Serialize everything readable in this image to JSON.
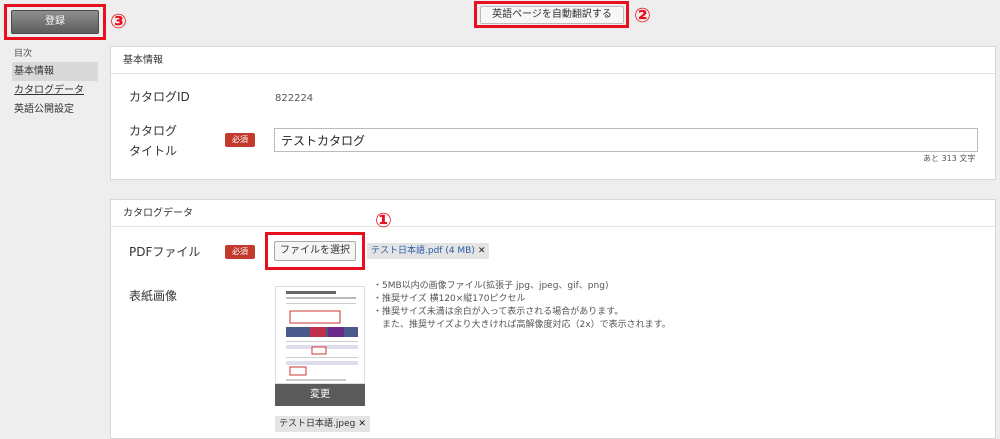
{
  "toolbar": {
    "register_label": "登録",
    "translate_label": "英語ページを自動翻訳する"
  },
  "annotations": {
    "one": "①",
    "two": "②",
    "three": "③"
  },
  "sidebar": {
    "heading": "目次",
    "items": [
      {
        "label": "基本情報",
        "state": "active"
      },
      {
        "label": "カタログデータ",
        "state": "link"
      },
      {
        "label": "英語公開設定",
        "state": "normal"
      }
    ]
  },
  "basic_info": {
    "section_title": "基本情報",
    "catalog_id_label": "カタログID",
    "catalog_id_value": "822224",
    "catalog_title_label_line1": "カタログ",
    "catalog_title_label_line2": "タイトル",
    "required_badge": "必須",
    "catalog_title_value": "テストカタログ",
    "chars_remaining": "あと 313 文字"
  },
  "catalog_data": {
    "section_title": "カタログデータ",
    "pdf_label": "PDFファイル",
    "required_badge": "必須",
    "file_select_label": "ファイルを選択",
    "pdf_file_name": "テスト日本語.pdf (4 MB)",
    "remove_symbol": "✕",
    "cover_label": "表紙画像",
    "notes": [
      "・5MB以内の画像ファイル(拡張子 jpg、jpeg、gif、png)",
      "・推奨サイズ 横120×縦170ピクセル",
      "・推奨サイズ未満は余白が入って表示される場合があります。",
      "　また、推奨サイズより大きければ高解像度対応（2x）で表示されます。"
    ],
    "change_label": "変更",
    "cover_file_name": "テスト日本語.jpeg"
  },
  "colors": {
    "annotation_red": "#e8101e",
    "required_red": "#c0392b"
  }
}
